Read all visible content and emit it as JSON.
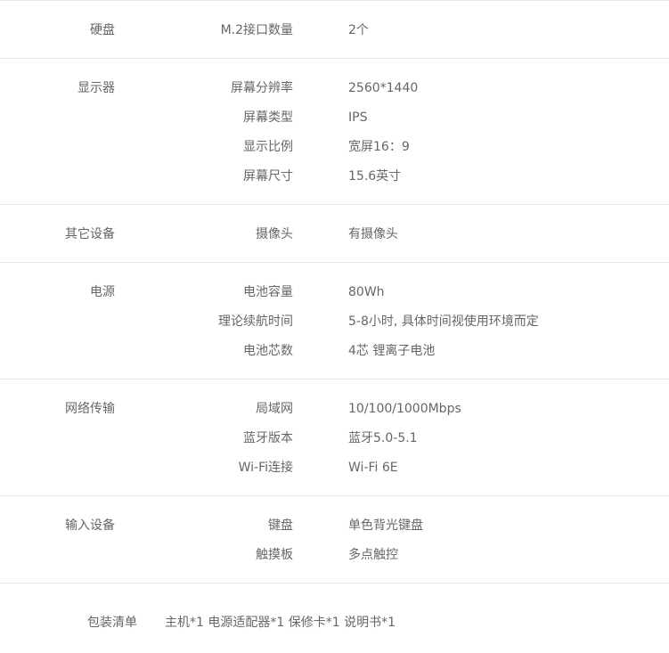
{
  "groups": [
    {
      "category": "硬盘",
      "rows": [
        {
          "key": "M.2接口数量",
          "value": "2个"
        }
      ]
    },
    {
      "category": "显示器",
      "rows": [
        {
          "key": "屏幕分辨率",
          "value": "2560*1440"
        },
        {
          "key": "屏幕类型",
          "value": "IPS"
        },
        {
          "key": "显示比例",
          "value": "宽屏16：9"
        },
        {
          "key": "屏幕尺寸",
          "value": "15.6英寸"
        }
      ]
    },
    {
      "category": "其它设备",
      "rows": [
        {
          "key": "摄像头",
          "value": "有摄像头"
        }
      ]
    },
    {
      "category": "电源",
      "rows": [
        {
          "key": "电池容量",
          "value": "80Wh"
        },
        {
          "key": "理论续航时间",
          "value": "5-8小时, 具体时间视使用环境而定"
        },
        {
          "key": "电池芯数",
          "value": "4芯 锂离子电池"
        }
      ]
    },
    {
      "category": "网络传输",
      "rows": [
        {
          "key": "局域网",
          "value": "10/100/1000Mbps"
        },
        {
          "key": "蓝牙版本",
          "value": "蓝牙5.0-5.1"
        },
        {
          "key": "Wi-Fi连接",
          "value": "Wi-Fi 6E"
        }
      ]
    },
    {
      "category": "输入设备",
      "rows": [
        {
          "key": "键盘",
          "value": "单色背光键盘"
        },
        {
          "key": "触摸板",
          "value": "多点触控"
        }
      ]
    }
  ],
  "package": {
    "label": "包装清单",
    "value": "主机*1 电源适配器*1 保修卡*1 说明书*1"
  }
}
